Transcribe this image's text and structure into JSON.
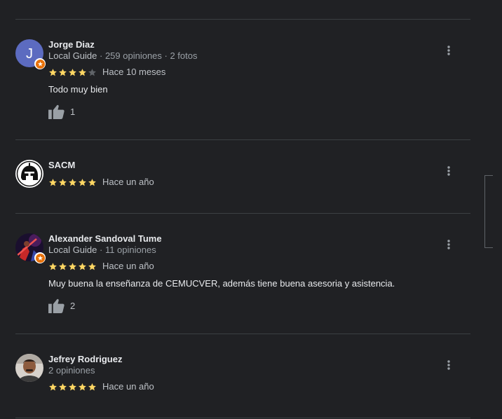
{
  "reviews": [
    {
      "name": "Jorge Diaz",
      "avatar_initial": "J",
      "avatar_color": "#5c6bc0",
      "local_guide": true,
      "meta_guide": "Local Guide",
      "meta_rest": " · 259 opiniones · 2 fotos",
      "rating": 4,
      "date": "Hace 10 meses",
      "text": "Todo muy bien",
      "likes": "1"
    },
    {
      "name": "SACM",
      "avatar_icon": "helmet-logo-icon",
      "local_guide": false,
      "rating": 5,
      "date": "Hace un año"
    },
    {
      "name": "Alexander Sandoval Tume",
      "avatar_icon": "photo-avatar",
      "local_guide": true,
      "meta_guide": "Local Guide",
      "meta_rest": " · 11 opiniones",
      "rating": 5,
      "date": "Hace un año",
      "text": "Muy buena la enseñanza de CEMUCVER, además tiene buena asesoria y asistencia.",
      "likes": "2"
    },
    {
      "name": "Jefrey Rodriguez",
      "avatar_icon": "photo-avatar",
      "local_guide": false,
      "meta_rest": "2 opiniones",
      "rating": 5,
      "date": "Hace un año"
    }
  ],
  "colors": {
    "background": "#202124",
    "star_filled": "#fdd663",
    "star_empty": "#5f6368",
    "badge": "#e8710a"
  }
}
